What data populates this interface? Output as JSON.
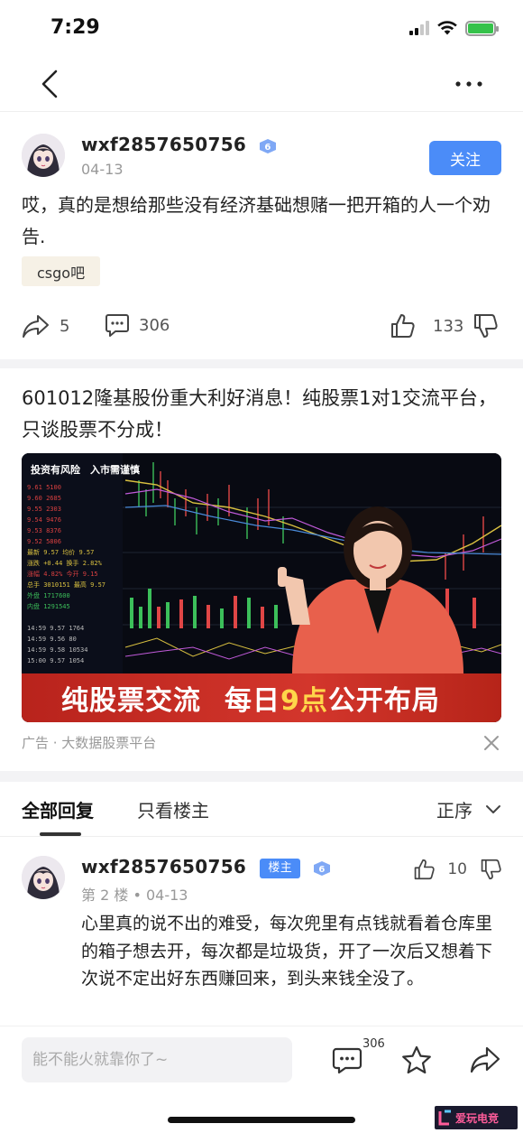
{
  "status": {
    "time": "7:29"
  },
  "post": {
    "username": "wxf2857650756",
    "level": "6",
    "date": "04-13",
    "follow_label": "关注",
    "body": "哎，真的是想给那些没有经济基础想赌一把开箱的人一个劝告.",
    "forum_tag": "csgo吧",
    "share_count": "5",
    "comment_count": "306",
    "like_count": "133"
  },
  "ad": {
    "title": "601012隆基股份重大利好消息！纯股票1对1交流平台，只谈股票不分成！",
    "image_warning": "投资有风险　入市需谨慎",
    "banner_part1": "纯股票交流",
    "banner_part2a": "每日",
    "banner_part2b": "9点",
    "banner_part2c": "公开布局",
    "source": "广告 · 大数据股票平台"
  },
  "tabs": {
    "all_replies": "全部回复",
    "owner_only": "只看楼主",
    "sort_label": "正序"
  },
  "reply": {
    "username": "wxf2857650756",
    "owner_badge": "楼主",
    "level": "6",
    "floor": "第 2 楼",
    "date": "04-13",
    "like_count": "10",
    "body": "心里真的说不出的难受，每次兜里有点钱就看着仓库里的箱子想去开，每次都是垃圾货，开了一次后又想着下次说不定出好东西赚回来，到头来钱全没了。"
  },
  "bottom_bar": {
    "input_placeholder": "能不能火就靠你了~",
    "comment_count": "306"
  },
  "watermark": {
    "text": "爱玩电竞"
  },
  "colors": {
    "accent": "#4b8cf8",
    "tag_bg": "#f6f1e6",
    "banner_red": "#c92c22",
    "banner_highlight": "#ffd64a"
  }
}
